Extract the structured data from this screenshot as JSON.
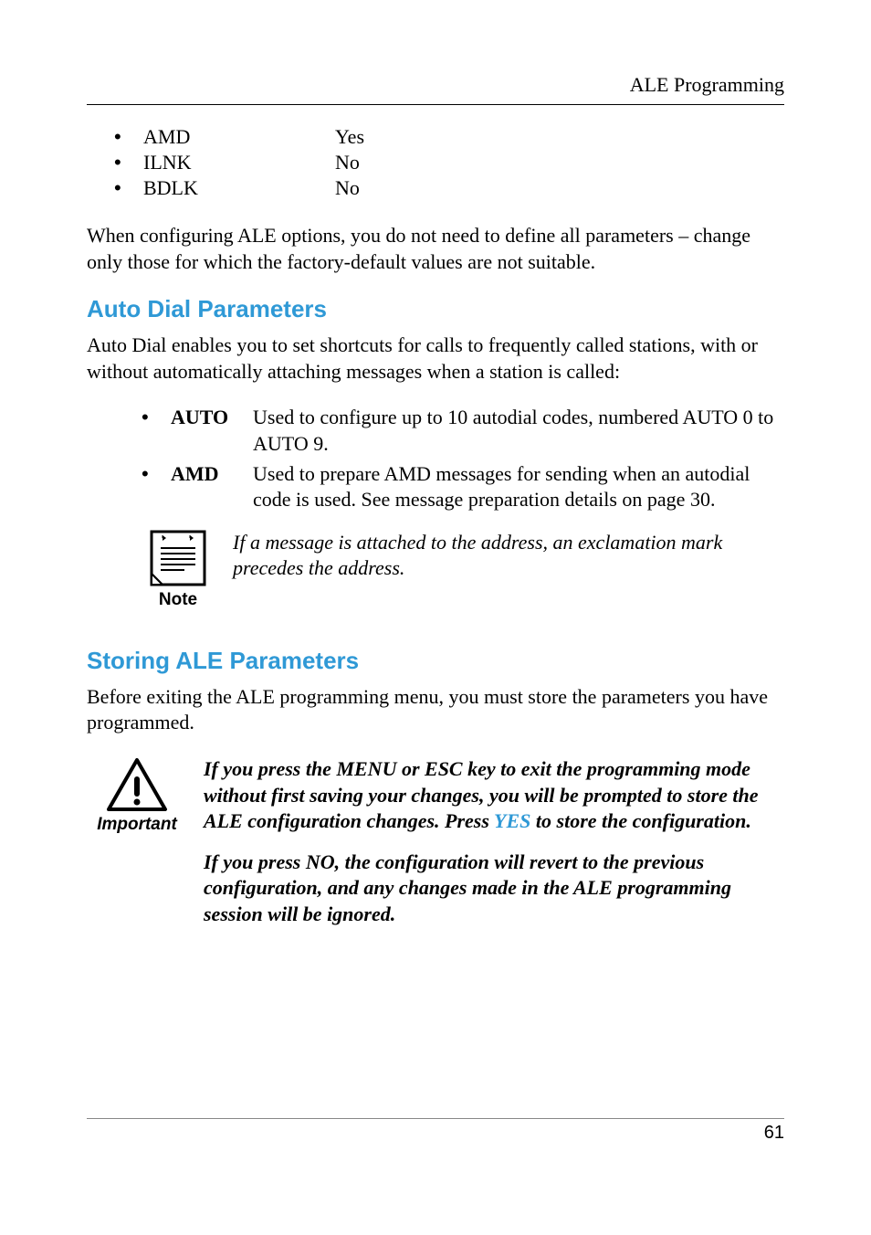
{
  "header": {
    "title": "ALE Programming"
  },
  "bullet_list": [
    {
      "label": "AMD",
      "value": "Yes"
    },
    {
      "label": "ILNK",
      "value": "No"
    },
    {
      "label": "BDLK",
      "value": "No"
    }
  ],
  "intro_paragraph": "When configuring ALE options, you do not need to define all parameters – change only those for which the factory-default values are not suitable.",
  "section1": {
    "heading": "Auto Dial Parameters",
    "paragraph": "Auto Dial enables you to set shortcuts for calls to frequently called stations, with or without automatically attaching messages when a station is called:",
    "definitions": [
      {
        "term": "AUTO",
        "desc": "Used to configure up to 10 autodial codes, numbered AUTO 0 to AUTO 9."
      },
      {
        "term": "AMD",
        "desc": "Used to prepare AMD messages for sending when an autodial code is used. See message preparation details on page 30."
      }
    ],
    "note": {
      "caption": "Note",
      "text": "If a message is attached to the address, an exclamation mark precedes the address."
    }
  },
  "section2": {
    "heading": "Storing ALE Parameters",
    "paragraph": "Before exiting the ALE programming menu, you must store the parameters you have programmed.",
    "important": {
      "caption": "Important",
      "text_before_yes": "If you press the MENU or ESC key to exit the programming mode without first saving your changes, you will be prompted to store the ALE configuration changes. Press ",
      "yes_word": "YES",
      "text_after_yes": " to store the configuration.",
      "text_p2": "If you press NO, the configuration will revert to the previous configuration, and any changes made in the ALE programming session will be ignored."
    }
  },
  "footer": {
    "page_number": "61"
  }
}
